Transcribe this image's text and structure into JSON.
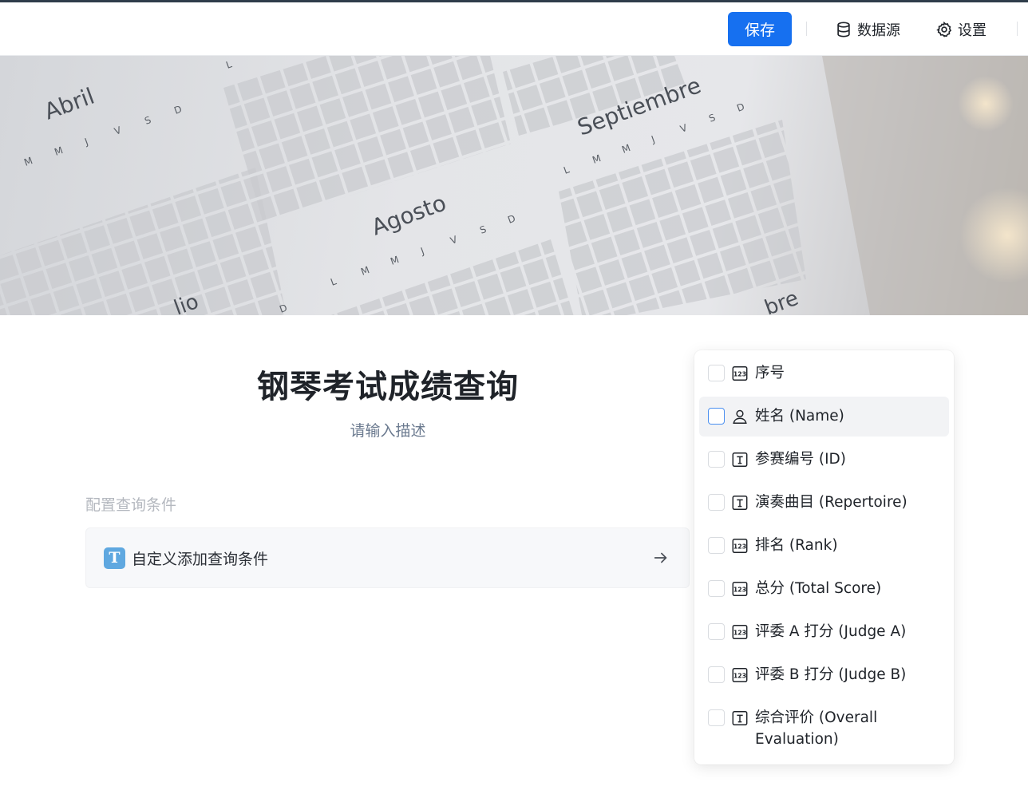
{
  "toolbar": {
    "save_label": "保存",
    "datasource_label": "数据源",
    "settings_label": "设置"
  },
  "banner": {
    "months": [
      "Abril",
      "Agosto",
      "Septiembre",
      "lio",
      "bre"
    ],
    "day_letters": [
      "L",
      "M",
      "M",
      "J",
      "V",
      "S",
      "D"
    ]
  },
  "page": {
    "title": "钢琴考试成绩查询",
    "description": "请输入描述",
    "section_label": "配置查询条件",
    "custom_condition_icon": "T",
    "custom_condition_label": "自定义添加查询条件"
  },
  "field_dropdown": {
    "hovered_index": 1,
    "items": [
      {
        "label": "序号",
        "icon": "number-icon",
        "checked": false
      },
      {
        "label": "姓名 (Name)",
        "icon": "person-icon",
        "checked": false
      },
      {
        "label": "参赛编号 (ID)",
        "icon": "text-icon",
        "checked": false
      },
      {
        "label": "演奏曲目 (Repertoire)",
        "icon": "text-icon",
        "checked": false
      },
      {
        "label": "排名 (Rank)",
        "icon": "number-icon",
        "checked": false
      },
      {
        "label": "总分 (Total Score)",
        "icon": "number-icon",
        "checked": false
      },
      {
        "label": "评委 A 打分 (Judge A)",
        "icon": "number-icon",
        "checked": false
      },
      {
        "label": "评委 B 打分 (Judge B)",
        "icon": "number-icon",
        "checked": false
      },
      {
        "label": "综合评价 (Overall Evaluation)",
        "icon": "text-icon",
        "checked": false
      }
    ]
  },
  "colors": {
    "primary": "#1670f0",
    "t_icon": "#5fa8e0",
    "muted_text": "#b4b8bf"
  }
}
